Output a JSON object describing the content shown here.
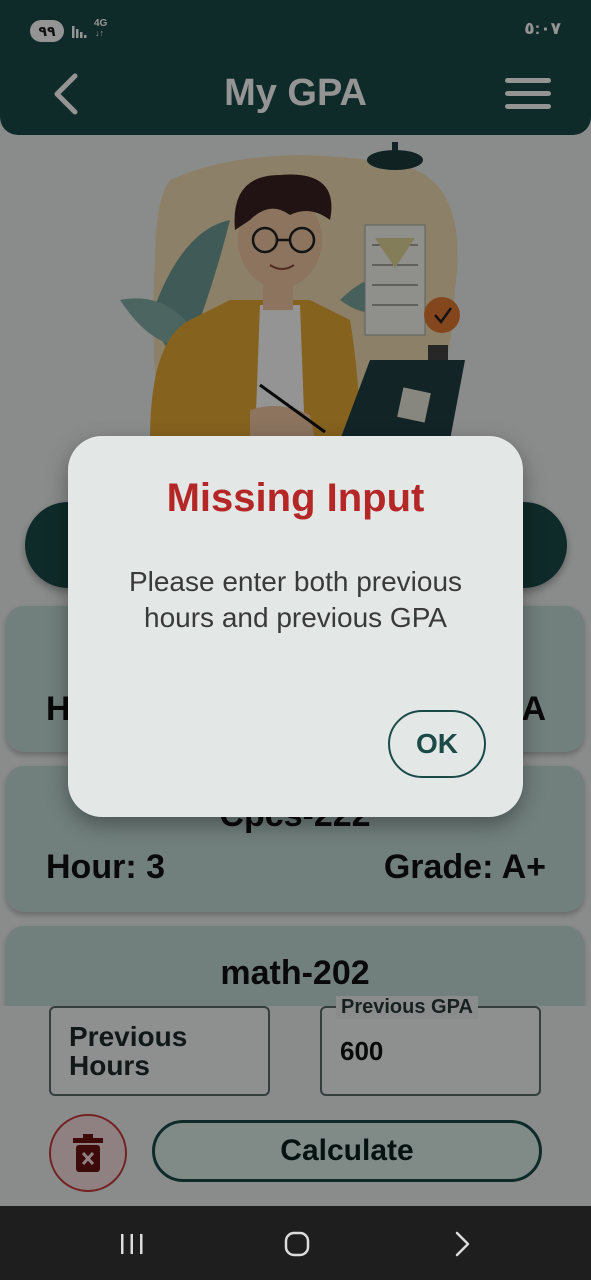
{
  "status": {
    "notification_count": "٩٩",
    "network": "4G",
    "network_arrows": "↓↑",
    "time": "٥:٠٧"
  },
  "app_bar": {
    "title": "My GPA",
    "back_icon": "chevron-left-icon",
    "menu_icon": "hamburger-menu-icon"
  },
  "courses": [
    {
      "name": "",
      "hour_label": "H",
      "grade_label": "A"
    },
    {
      "name": "Cpcs-222",
      "hour_label": "Hour: 3",
      "grade_label": "Grade: A+"
    },
    {
      "name": "math-202"
    }
  ],
  "inputs": {
    "previous_hours": {
      "placeholder": "Previous Hours",
      "value": ""
    },
    "previous_gpa": {
      "label": "Previous GPA",
      "value": "600"
    }
  },
  "actions": {
    "calculate_label": "Calculate",
    "delete_icon": "trash-icon"
  },
  "dialog": {
    "title": "Missing Input",
    "message": "Please enter both previous hours and previous GPA",
    "ok_label": "OK"
  },
  "colors": {
    "primary": "#1b4a47",
    "card": "#c4dcd7",
    "error": "#b52727",
    "dialog_bg": "#e3e8e7"
  }
}
